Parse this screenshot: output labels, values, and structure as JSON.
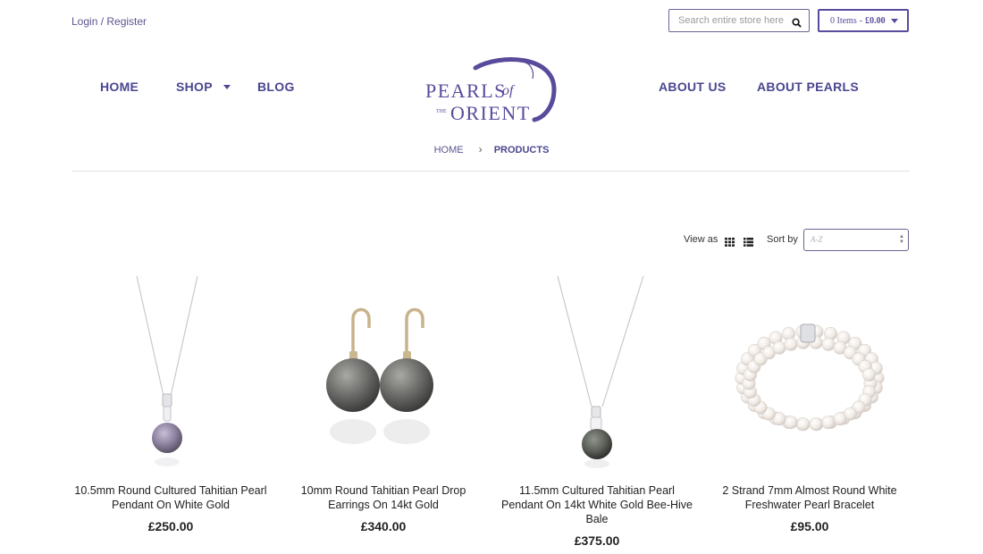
{
  "header": {
    "login_label": "Login / Register",
    "search_placeholder": "Search entire store here",
    "cart": {
      "items": "0 Items",
      "dash": "-",
      "total": "£0.00"
    }
  },
  "nav": {
    "home": "HOME",
    "shop": "SHOP",
    "blog": "BLOG",
    "about_us": "ABOUT US",
    "about_pearls": "ABOUT PEARLS"
  },
  "logo": {
    "line1": "PEARLS",
    "of": "of",
    "the": "THE",
    "line2": "ORIENT"
  },
  "breadcrumb": {
    "home": "HOME",
    "separator": "›",
    "current": "PRODUCTS"
  },
  "toolbar": {
    "view_as": "View as",
    "sort_by": "Sort by",
    "sort_value": "A-Z"
  },
  "products": [
    {
      "name": "10.5mm Round Cultured Tahitian Pearl Pendant On White Gold",
      "price": "£250.00",
      "image": "pendant-lavender-pearl"
    },
    {
      "name": "10mm Round Tahitian Pearl Drop Earrings On 14kt Gold",
      "price": "£340.00",
      "image": "drop-earrings-grey-pearl"
    },
    {
      "name": "11.5mm Cultured Tahitian Pearl Pendant On 14kt White Gold Bee-Hive Bale",
      "price": "£375.00",
      "image": "pendant-dark-pearl"
    },
    {
      "name": "2 Strand 7mm Almost Round White Freshwater Pearl Bracelet",
      "price": "£95.00",
      "image": "two-strand-pearl-bracelet"
    }
  ],
  "colors": {
    "brand": "#4a4690",
    "accent": "#5a4a9b",
    "text": "#222222"
  }
}
